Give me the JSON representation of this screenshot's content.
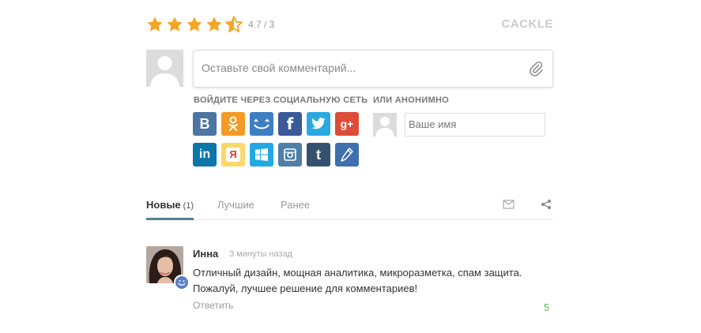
{
  "rating": {
    "text": "4.7 / 3",
    "stars_value": 4.5,
    "star_color": "#f5a623"
  },
  "brand": "CACKLE",
  "comment_form": {
    "placeholder": "Оставьте свой комментарий..."
  },
  "login": {
    "social_label": "ВОЙДИТЕ ЧЕРЕЗ СОЦИАЛЬНУЮ СЕТЬ",
    "anon_label": "ИЛИ АНОНИМНО",
    "name_placeholder": "Ваше имя",
    "networks": [
      {
        "name": "vk",
        "glyph": "B",
        "color": "#4c75a3"
      },
      {
        "name": "odnoklassniki",
        "glyph": "ok",
        "color": "#f59a24"
      },
      {
        "name": "mailru",
        "glyph": "smile",
        "color": "#3d7fc2"
      },
      {
        "name": "facebook",
        "glyph": "f",
        "color": "#3b5998"
      },
      {
        "name": "twitter",
        "glyph": "bird",
        "color": "#2aa9e0"
      },
      {
        "name": "google-plus",
        "glyph": "g+",
        "color": "#dd4b39"
      },
      {
        "name": "linkedin",
        "glyph": "in",
        "color": "#0e76a8"
      },
      {
        "name": "yandex",
        "glyph": "Я",
        "color": "#fad96b"
      },
      {
        "name": "windows-live",
        "glyph": "win",
        "color": "#23a9e1"
      },
      {
        "name": "instagram",
        "glyph": "cam",
        "color": "#4f7fa8"
      },
      {
        "name": "tumblr",
        "glyph": "t",
        "color": "#34526f"
      },
      {
        "name": "openid",
        "glyph": "pen",
        "color": "#3e6fae"
      }
    ]
  },
  "tabs": [
    {
      "label": "Новые",
      "count": "(1)",
      "active": true
    },
    {
      "label": "Лучшие",
      "count": "",
      "active": false
    },
    {
      "label": "Ранее",
      "count": "",
      "active": false
    }
  ],
  "comments": [
    {
      "author": "Инна",
      "time": "3 минуты назад",
      "text_line1": "Отличный дизайн, мощная аналитика, микроразметка, спам защита.",
      "text_line2": "Пожалуй, лучшее решение для комментариев!",
      "reply_label": "Ответить",
      "votes": "5"
    }
  ]
}
